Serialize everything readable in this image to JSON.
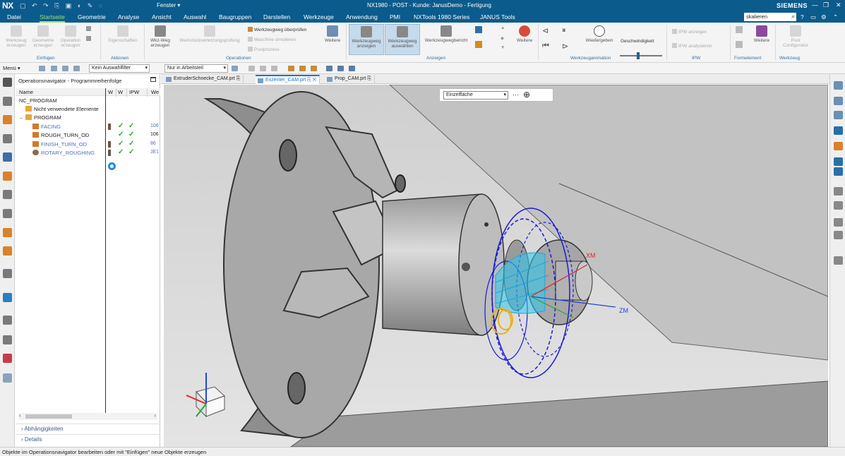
{
  "titlebar": {
    "logo": "NX",
    "fenster": "Fenster ▾",
    "title": "NX1980 - POST - Kunde: JanusDemo - Fertigung",
    "brand": "SIEMENS"
  },
  "menu": {
    "items": [
      "Datei",
      "Startseite",
      "Geometrie",
      "Analyse",
      "Ansicht",
      "Auswahl",
      "Baugruppen",
      "Darstellen",
      "Werkzeuge",
      "Anwendung",
      "PMI",
      "NXTools 1980 Series",
      "JANUS Tools"
    ],
    "active_index": 1,
    "search_value": "skalieren"
  },
  "ribbon": {
    "einfuegen": {
      "buttons": [
        "Werkzeug erzeugen",
        "Geometrie erzeugen",
        "Operation erzeugen"
      ],
      "group": "Einfügen"
    },
    "aktionen": {
      "button": "Eigenschaften",
      "group": "Aktionen"
    },
    "operationen": {
      "wkz": "Wkz-Weg erzeugen",
      "pruef": "Werkstückverletzungsprüfung",
      "check": "Werkzeugweg überprüfen",
      "sim": "Maschine simulieren",
      "post": "Postprozess",
      "weitere": "Weitere",
      "group": "Operationen"
    },
    "anzeigen": {
      "show": "Werkzeugweg anzeigen",
      "select": "Werkzeugweg auswählen",
      "report": "Werkzeugwegbericht",
      "weitere": "Weitere",
      "group": "Anzeigen"
    },
    "animation": {
      "play": "Wiedergeben",
      "speed": "Geschwindigkeit",
      "group": "Werkzeuganimation"
    },
    "ipw": {
      "show": "IPW anzeigen",
      "analyze": "IPW analysieren",
      "group": "IPW"
    },
    "formelement": {
      "weitere": "Weitere",
      "group": "Formelement"
    },
    "werkzeug": {
      "post": "Post Configurator",
      "group": "Werkzeug"
    }
  },
  "selbar": {
    "menu": "Menü ▾",
    "filter": "Kein Auswahlfilter",
    "scope": "Nur in Arbeitsteil"
  },
  "navigator": {
    "title": "Operationsnavigator - Programmreihenfolge",
    "columns": [
      "Name",
      "W",
      "W",
      "IPW",
      "We"
    ],
    "rows": [
      {
        "name": "NC_PROGRAM"
      },
      {
        "name": "Nicht verwendete Elemente"
      },
      {
        "name": "PROGRAM"
      },
      {
        "name": "FACING",
        "num": "106"
      },
      {
        "name": "ROUGH_TURN_OD",
        "num": "106"
      },
      {
        "name": "FINISH_TURN_OD",
        "num": "86"
      },
      {
        "name": "ROTARY_ROUGHING",
        "num": "JE1"
      }
    ],
    "panels": [
      "Abhängigkeiten",
      "Details"
    ]
  },
  "tabs": [
    {
      "label": "ExtruderSchnecke_CAM.prt"
    },
    {
      "label": "Exzenter_CAM.prt"
    },
    {
      "label": "Prop_CAM.prt"
    }
  ],
  "viewport": {
    "filter_value": "Einzelfläche",
    "axis_x": "XM",
    "axis_z": "ZM"
  },
  "status": "Objekte im Operationsnavigator bearbeiten oder mit \"Einfügen\" neue Objekte erzeugen",
  "colors": {
    "titlebar": "#0b5b8c",
    "active_tab": "#9fe36a",
    "check": "#2da62d",
    "toolpath_blue": "#1a1ad6",
    "toolpath_cyan": "#2cc9ef"
  }
}
